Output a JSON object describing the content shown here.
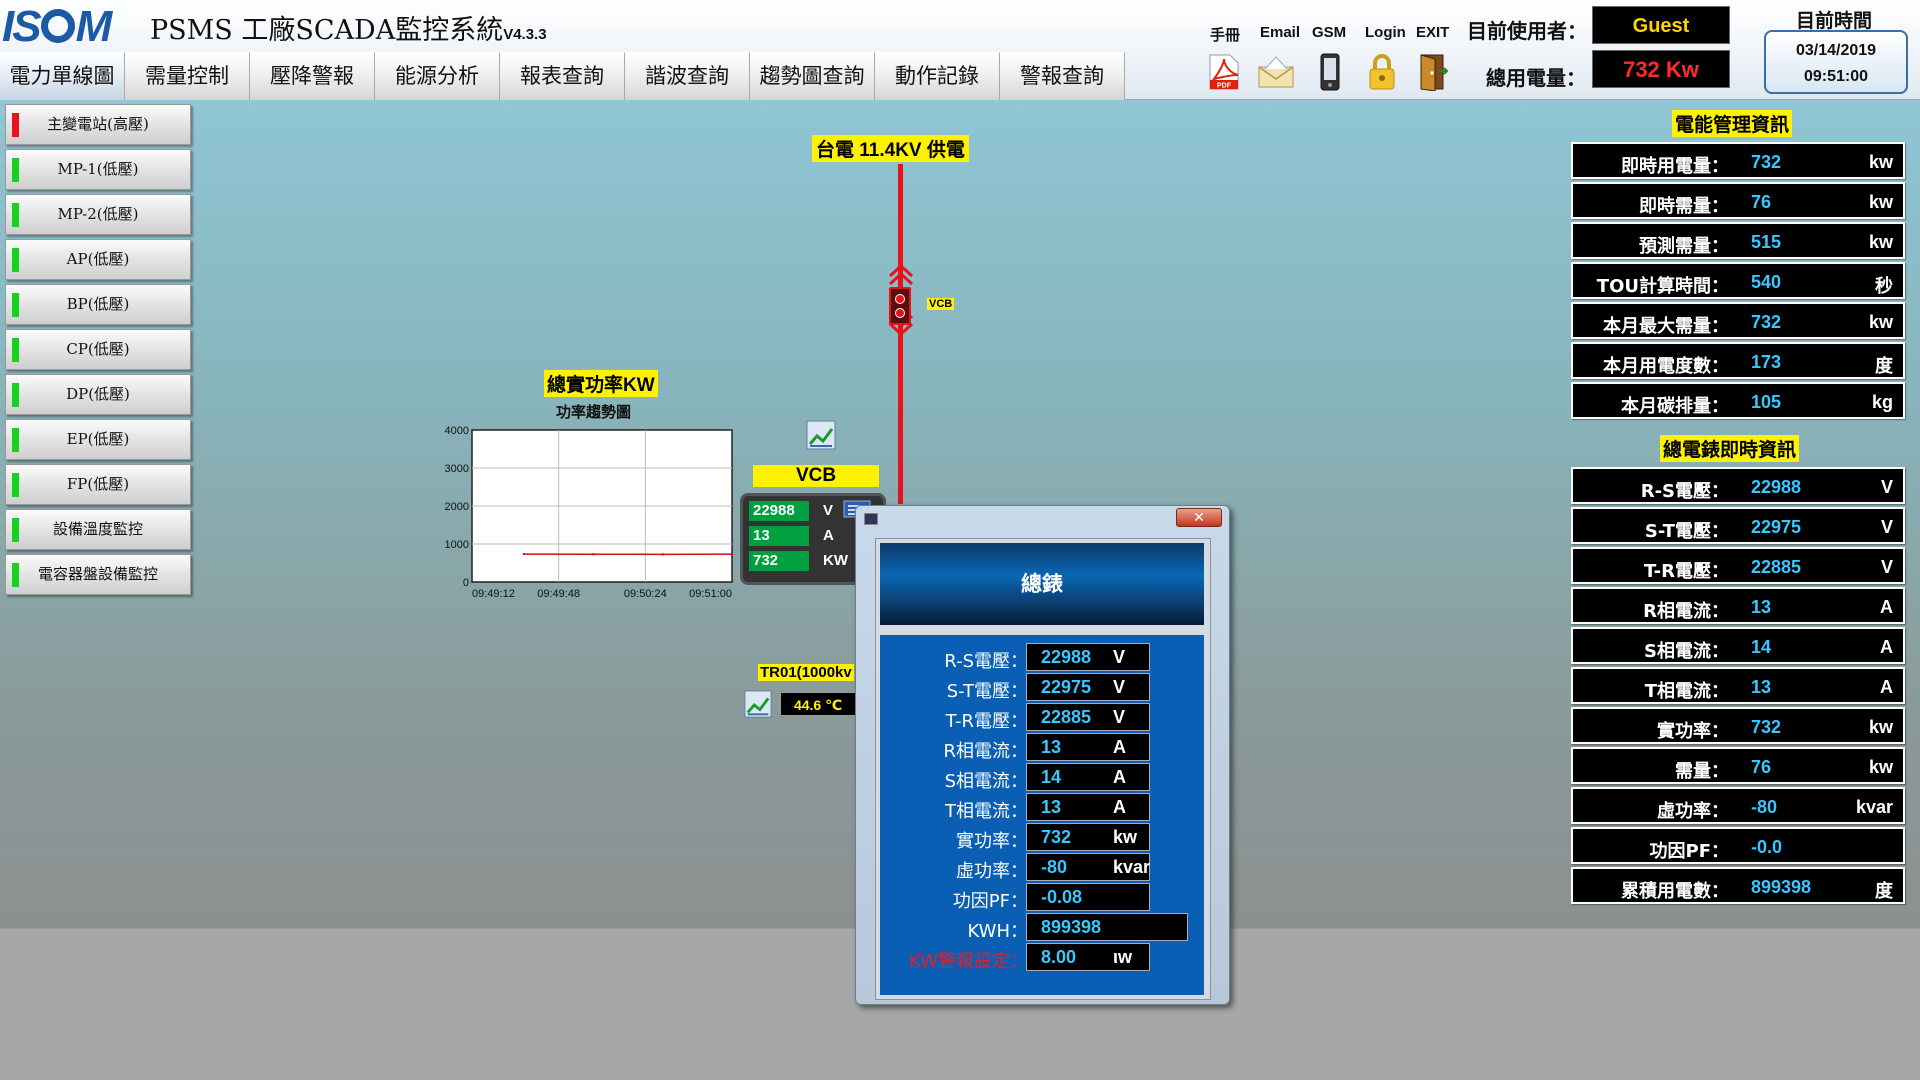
{
  "header": {
    "logo": "ISOM",
    "title": "PSMS 工廠SCADA監控系統",
    "version": "V4.3.3",
    "tools": [
      {
        "label": "手冊",
        "icon": "pdf-icon"
      },
      {
        "label": "Email",
        "icon": "email-icon"
      },
      {
        "label": "GSM",
        "icon": "phone-icon"
      },
      {
        "label": "Login",
        "icon": "lock-icon"
      },
      {
        "label": "EXIT",
        "icon": "exit-door-icon"
      }
    ],
    "user_label": "目前使用者：",
    "user_value": "Guest",
    "power_label": "總用電量：",
    "power_value": "732 Kw",
    "time_label": "目前時間",
    "date": "03/14/2019",
    "time": "09:51:00"
  },
  "nav": [
    "電力單線圖",
    "需量控制",
    "壓降警報",
    "能源分析",
    "報表查詢",
    "諧波查詢",
    "趨勢圖查詢",
    "動作記錄",
    "警報查詢"
  ],
  "sidebar": [
    {
      "label": "主變電站(高壓)",
      "status": "#e8121c"
    },
    {
      "label": "MP-1(低壓)",
      "status": "#14d21e"
    },
    {
      "label": "MP-2(低壓)",
      "status": "#14d21e"
    },
    {
      "label": "AP(低壓)",
      "status": "#14d21e"
    },
    {
      "label": "BP(低壓)",
      "status": "#14d21e"
    },
    {
      "label": "CP(低壓)",
      "status": "#14d21e"
    },
    {
      "label": "DP(低壓)",
      "status": "#14d21e"
    },
    {
      "label": "EP(低壓)",
      "status": "#14d21e"
    },
    {
      "label": "FP(低壓)",
      "status": "#14d21e"
    },
    {
      "label": "設備溫度監控",
      "status": "#14d21e"
    },
    {
      "label": "電容器盤設備監控",
      "status": "#14d21e"
    }
  ],
  "diagram": {
    "supply_label": "台電 11.4KV 供電",
    "breaker_label": "VCB",
    "trend_title": "總實功率KW",
    "trend_subtitle": "功率趨勢圖",
    "vcb_label": "VCB",
    "vcb_values": [
      {
        "value": "22988",
        "unit": "V"
      },
      {
        "value": "13",
        "unit": "A"
      },
      {
        "value": "732",
        "unit": "KW"
      }
    ],
    "tr_label": "TR01(1000kv",
    "tr_temp": "44.6 ℃"
  },
  "chart_data": {
    "type": "line",
    "title": "功率趨勢圖",
    "x_ticks": [
      "09:49:12",
      "09:49:48",
      "09:50:24",
      "09:51:00"
    ],
    "y_ticks": [
      0,
      1000,
      2000,
      3000,
      4000
    ],
    "ylim": [
      0,
      4000
    ],
    "grid": true,
    "series": [
      {
        "color": "#d01010",
        "x": [
          "09:49:12",
          "09:49:48",
          "09:50:24",
          "09:51:00"
        ],
        "values": [
          735,
          730,
          728,
          732
        ]
      }
    ]
  },
  "dialog": {
    "title": "總錶",
    "close": "✕",
    "rows": [
      {
        "label": "R-S電壓：",
        "value": "22988",
        "unit": "V"
      },
      {
        "label": "S-T電壓：",
        "value": "22975",
        "unit": "V"
      },
      {
        "label": "T-R電壓：",
        "value": "22885",
        "unit": "V"
      },
      {
        "label": "R相電流：",
        "value": "13",
        "unit": "A"
      },
      {
        "label": "S相電流：",
        "value": "14",
        "unit": "A"
      },
      {
        "label": "T相電流：",
        "value": "13",
        "unit": "A"
      },
      {
        "label": "實功率：",
        "value": "732",
        "unit": "kw"
      },
      {
        "label": "虛功率：",
        "value": "-80",
        "unit": "kvar"
      },
      {
        "label": "功因PF：",
        "value": "-0.08",
        "unit": ""
      },
      {
        "label": "KWH：",
        "value": "899398",
        "unit": ""
      },
      {
        "label": "KW警報設定：",
        "value": "8.00",
        "unit": "ιw"
      }
    ]
  },
  "energy_panel": {
    "title": "電能管理資訊",
    "rows": [
      {
        "label": "即時用電量：",
        "value": "732",
        "unit": "kw"
      },
      {
        "label": "即時需量：",
        "value": "76",
        "unit": "kw"
      },
      {
        "label": "預測需量：",
        "value": "515",
        "unit": "kw"
      },
      {
        "label": "TOU計算時間：",
        "value": "540",
        "unit": "秒"
      },
      {
        "label": "本月最大需量：",
        "value": "732",
        "unit": "kw"
      },
      {
        "label": "本月用電度數：",
        "value": "173",
        "unit": "度"
      },
      {
        "label": "本月碳排量：",
        "value": "105",
        "unit": "kg"
      }
    ]
  },
  "meter_panel": {
    "title": "總電錶即時資訊",
    "rows": [
      {
        "label": "R-S電壓：",
        "value": "22988",
        "unit": "V"
      },
      {
        "label": "S-T電壓：",
        "value": "22975",
        "unit": "V"
      },
      {
        "label": "T-R電壓：",
        "value": "22885",
        "unit": "V"
      },
      {
        "label": "R相電流：",
        "value": "13",
        "unit": "A"
      },
      {
        "label": "S相電流：",
        "value": "14",
        "unit": "A"
      },
      {
        "label": "T相電流：",
        "value": "13",
        "unit": "A"
      },
      {
        "label": "實功率：",
        "value": "732",
        "unit": "kw"
      },
      {
        "label": "需量：",
        "value": "76",
        "unit": "kw"
      },
      {
        "label": "虛功率：",
        "value": "-80",
        "unit": "kvar"
      },
      {
        "label": "功因PF：",
        "value": "-0.0",
        "unit": ""
      },
      {
        "label": "累積用電數：",
        "value": "899398",
        "unit": "度"
      }
    ]
  }
}
